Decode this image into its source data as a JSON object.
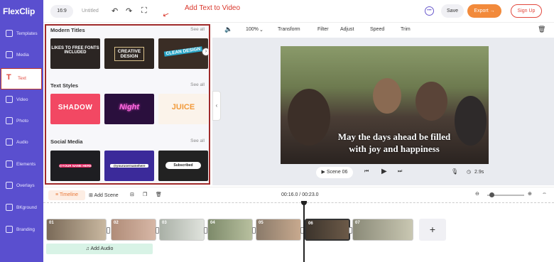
{
  "app": {
    "logo": "FlexClip"
  },
  "sidebar": {
    "items": [
      {
        "label": "Templates"
      },
      {
        "label": "Media"
      },
      {
        "label": "Text"
      },
      {
        "label": "Video"
      },
      {
        "label": "Photo"
      },
      {
        "label": "Audio"
      },
      {
        "label": "Elements"
      },
      {
        "label": "Overlays"
      },
      {
        "label": "BKground"
      },
      {
        "label": "Branding"
      }
    ],
    "active_icon": "T"
  },
  "topbar": {
    "ratio": "16:9",
    "project_name": "Untitled",
    "annotation": "Add Text to Video",
    "save_label": "Save",
    "export_label": "Export",
    "signup_label": "Sign Up"
  },
  "panel": {
    "sections": [
      {
        "title": "Modern Titles",
        "see_all": "See all",
        "thumbs": [
          "LIKES TO FREE FONTS INCLUDED",
          "CREATIVE DESIGN",
          "CLEAN DESIGN"
        ]
      },
      {
        "title": "Text Styles",
        "see_all": "See all",
        "thumbs": [
          "SHADOW",
          "Night",
          "JUICE"
        ]
      },
      {
        "title": "Social Media",
        "see_all": "See all",
        "thumbs": [
          "@YOUR NAME HERE",
          "@yourusernamehere",
          "Subscribed"
        ]
      }
    ]
  },
  "editor_toolbar": {
    "zoom": "100%",
    "items": [
      "Transform",
      "Filter",
      "Adjust",
      "Speed",
      "Trim"
    ]
  },
  "video": {
    "caption_line1": "May the days ahead be filled",
    "caption_line2": "with joy and happiness"
  },
  "controls": {
    "scene": "Scene 06",
    "duration": "2.9s"
  },
  "timeline": {
    "tab_label": "Timeline",
    "add_scene": "Add Scene",
    "time": "00:16.0 / 00:23.0",
    "clips": [
      "01",
      "02",
      "03",
      "04",
      "05",
      "06",
      "07"
    ],
    "add_audio": "Add Audio"
  }
}
